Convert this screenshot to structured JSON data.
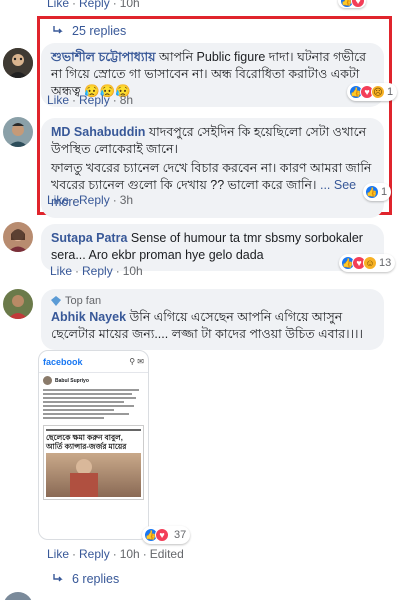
{
  "top_meta": {
    "like": "Like",
    "reply": "Reply",
    "time": "10h"
  },
  "thread_top": {
    "replies_label": "25 replies"
  },
  "comments": [
    {
      "name": "শুভাশীল চট্টোপাধ্যায়",
      "text": "আপনি Public figure দাদা। ঘটনার গভীরে না গিয়ে স্রোতে গা ভাসাবেন না। অন্ধ বিরোধিতা করাটাও একটা অন্ধত্ব",
      "emoji": "😥😥😥",
      "like": "Like",
      "reply": "Reply",
      "time": "8h",
      "reaction_count": "1"
    },
    {
      "name": "MD Sahabuddin",
      "text": "যাদবপুরে সেইদিন কি হয়েছিলো সেটা ওখানে উপস্থিত লোকেরাই জানে।",
      "text2": "ফালতু খবরের চ্যানেল দেখে বিচার করবেন না। কারণ আমরা জানি খবরের চ্যানেল গুলো কি দেখায় ?? ভালো করে জানি।",
      "see_more": "... See more",
      "like": "Like",
      "reply": "Reply",
      "time": "3h",
      "reaction_count": "1"
    },
    {
      "name": "Sutapa Patra",
      "text": "Sense of humour ta tmr sbsmy sorbokaler sera... Aro ekbr proman hye gelo dada",
      "like": "Like",
      "reply": "Reply",
      "time": "10h",
      "reaction_count": "13"
    },
    {
      "badge": "Top fan",
      "name": "Abhik Nayek",
      "text": "উনি এগিয়ে এসেছেন আপনি এগিয়ে আসুন ছেলেটার মায়ের জন্য.... লজ্জা টা কাদের পাওয়া উচিত এবার।।।।",
      "like": "Like",
      "reply": "Reply",
      "time": "10h",
      "edited": "Edited",
      "reaction_count": "37",
      "attachment": {
        "app_name": "facebook",
        "profile_name": "Babul Supriyo",
        "headline": "ছেলেকে ক্ষমা করুন বাবুল, আর্তি ক্যান্সার-জর্জর মায়ের"
      }
    }
  ],
  "thread_bottom": {
    "replies_label": "6 replies"
  },
  "colors": {
    "link": "#385898",
    "highlight_border": "#e0242c",
    "bubble": "#f0f2f5"
  }
}
